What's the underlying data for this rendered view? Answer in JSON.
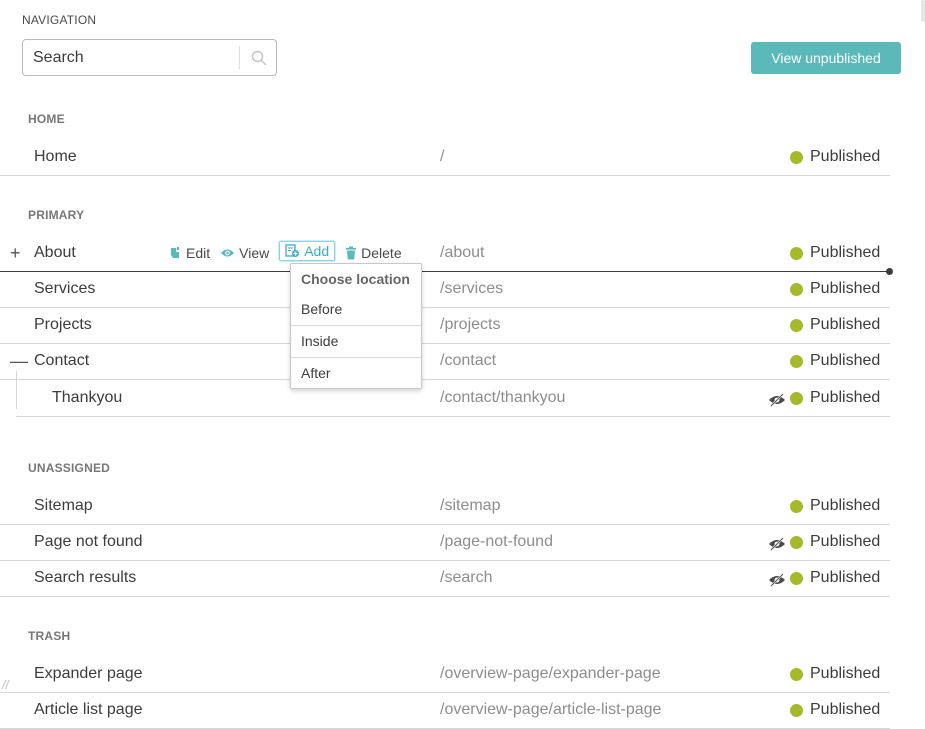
{
  "header": {
    "title": "NAVIGATION",
    "search_placeholder": "Search",
    "view_unpublished_label": "View unpublished"
  },
  "sections": {
    "home": {
      "title": "HOME"
    },
    "primary": {
      "title": "PRIMARY"
    },
    "unassigned": {
      "title": "UNASSIGNED"
    },
    "trash": {
      "title": "TRASH"
    }
  },
  "rows": {
    "home": {
      "name": "Home",
      "path": "/",
      "status": "Published"
    },
    "about": {
      "name": "About",
      "path": "/about",
      "status": "Published",
      "expander": "+"
    },
    "services": {
      "name": "Services",
      "path": "/services",
      "status": "Published"
    },
    "projects": {
      "name": "Projects",
      "path": "/projects",
      "status": "Published"
    },
    "contact": {
      "name": "Contact",
      "path": "/contact",
      "status": "Published",
      "expander": "—"
    },
    "thankyou": {
      "name": "Thankyou",
      "path": "/contact/thankyou",
      "status": "Published",
      "hidden": true
    },
    "sitemap": {
      "name": "Sitemap",
      "path": "/sitemap",
      "status": "Published"
    },
    "page_not_found": {
      "name": "Page not found",
      "path": "/page-not-found",
      "status": "Published",
      "hidden": true
    },
    "search_results": {
      "name": "Search results",
      "path": "/search",
      "status": "Published",
      "hidden": true
    },
    "expander_page": {
      "name": "Expander page",
      "path": "/overview-page/expander-page",
      "status": "Published"
    },
    "article_list_page": {
      "name": "Article list page",
      "path": "/overview-page/article-list-page",
      "status": "Published"
    }
  },
  "row_actions": {
    "edit": "Edit",
    "view": "View",
    "add": "Add",
    "delete": "Delete"
  },
  "dropdown": {
    "title": "Choose location",
    "options": [
      "Before",
      "Inside",
      "After"
    ]
  },
  "colors": {
    "accent": "#5bbab9",
    "published_dot": "#a5b92b",
    "add_action": "#3fa9c4"
  },
  "icons": {
    "search": "search-icon",
    "edit": "edit-icon",
    "view": "eye-icon",
    "add": "add-page-icon",
    "delete": "trash-icon",
    "hidden": "eye-slash-icon"
  }
}
